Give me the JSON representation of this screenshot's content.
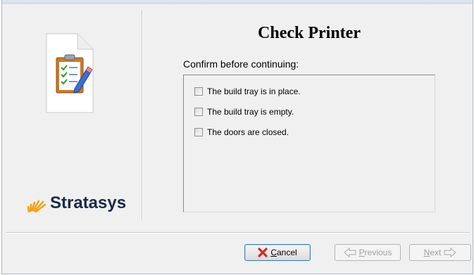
{
  "title": "Check Printer",
  "prompt": "Confirm before continuing:",
  "brand": {
    "name": "Stratasys"
  },
  "checklist": [
    {
      "label": "The build tray is in place.",
      "checked": false
    },
    {
      "label": "The build tray is empty.",
      "checked": false
    },
    {
      "label": "The doors are closed.",
      "checked": false
    }
  ],
  "buttons": {
    "cancel": {
      "mnemonic": "C",
      "rest": "ancel",
      "icon": "red-x-icon",
      "enabled": true
    },
    "previous": {
      "mnemonic": "P",
      "rest": "revious",
      "icon": "arrow-left-icon",
      "enabled": false
    },
    "next": {
      "mnemonic": "N",
      "rest": "ext",
      "icon": "arrow-right-icon",
      "enabled": false
    }
  },
  "icons": {
    "wizard": "clipboard-checklist-icon",
    "brand_mark": "stratasys-sunburst-icon"
  },
  "colors": {
    "brand_orange": "#f5a21a",
    "brand_text": "#1a2a4a",
    "cancel_x": "#d42a1f"
  }
}
